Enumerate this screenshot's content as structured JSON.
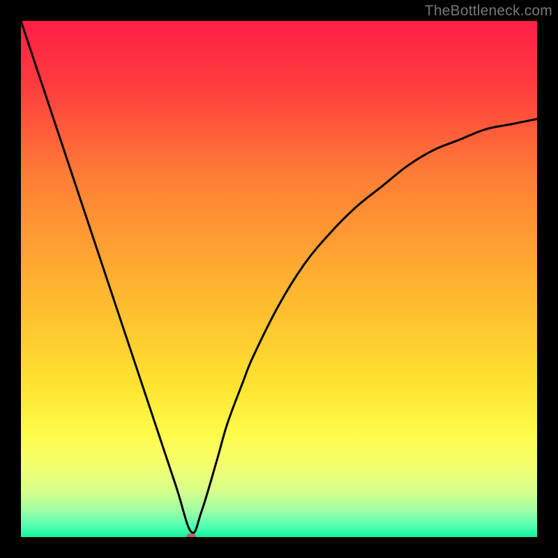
{
  "watermark": "TheBottleneck.com",
  "chart_data": {
    "type": "line",
    "title": "",
    "xlabel": "",
    "ylabel": "",
    "xlim": [
      0,
      100
    ],
    "ylim": [
      0,
      100
    ],
    "grid": false,
    "legend": false,
    "series": [
      {
        "name": "bottleneck-curve",
        "x": [
          0,
          5,
          10,
          15,
          20,
          25,
          30,
          33,
          35,
          38,
          40,
          43,
          45,
          50,
          55,
          60,
          65,
          70,
          75,
          80,
          85,
          90,
          95,
          100
        ],
        "values": [
          100,
          85,
          70,
          55,
          40,
          25,
          10,
          1,
          5,
          15,
          22,
          30,
          35,
          45,
          53,
          59,
          64,
          68,
          72,
          75,
          77,
          79,
          80,
          81
        ]
      }
    ],
    "background_gradient": {
      "stops": [
        {
          "offset": 0.0,
          "color": "#ff1f47"
        },
        {
          "offset": 0.12,
          "color": "#ff3a3e"
        },
        {
          "offset": 0.3,
          "color": "#ff7d36"
        },
        {
          "offset": 0.5,
          "color": "#ffb030"
        },
        {
          "offset": 0.7,
          "color": "#ffe22f"
        },
        {
          "offset": 0.8,
          "color": "#fffb4b"
        },
        {
          "offset": 0.86,
          "color": "#f4ff6d"
        },
        {
          "offset": 0.91,
          "color": "#d7ff8b"
        },
        {
          "offset": 0.95,
          "color": "#9cffa6"
        },
        {
          "offset": 0.98,
          "color": "#4cffb0"
        },
        {
          "offset": 1.0,
          "color": "#12f59e"
        }
      ]
    },
    "marker": {
      "x": 33,
      "y": 0,
      "color": "#b56269"
    }
  }
}
